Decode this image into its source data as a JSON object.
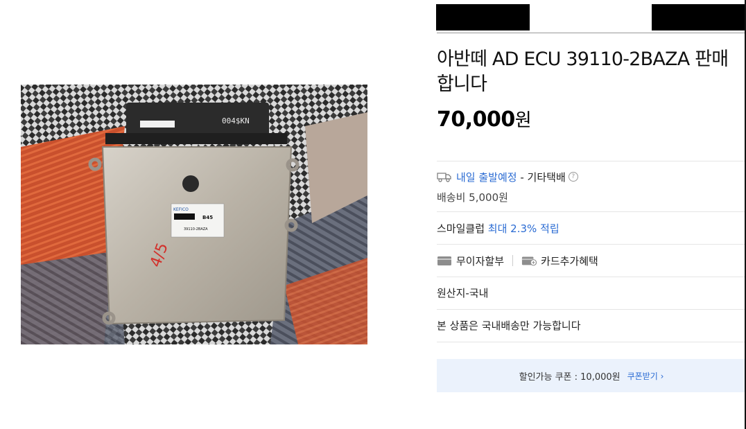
{
  "product": {
    "title": "아반떼 AD ECU 39110-2BAZA 판매합니다",
    "price": "70,000",
    "price_unit": "원"
  },
  "photo": {
    "marking_top": "004$KN",
    "handwriting": "4/5",
    "label_brand": "KEFICO",
    "label_code": "B45",
    "label_part": "39110-2BAZA"
  },
  "shipping": {
    "eta": "내일 출발예정",
    "method": "- 기타택배",
    "help": "?",
    "fee": "배송비 5,000원"
  },
  "smileclub": {
    "label": "스마일클럽",
    "benefit": "최대 2.3% 적립"
  },
  "payment": {
    "installment": "무이자할부",
    "card_benefit": "카드추가혜택"
  },
  "origin": "원산지-국내",
  "domestic_note": "본 상품은 국내배송만 가능합니다",
  "coupon": {
    "text": "할인가능 쿠폰 : 10,000원",
    "link": "쿠폰받기 ›"
  },
  "colors": {
    "accent_blue": "#2a6bd3",
    "coupon_bg": "#ebf2fc"
  }
}
